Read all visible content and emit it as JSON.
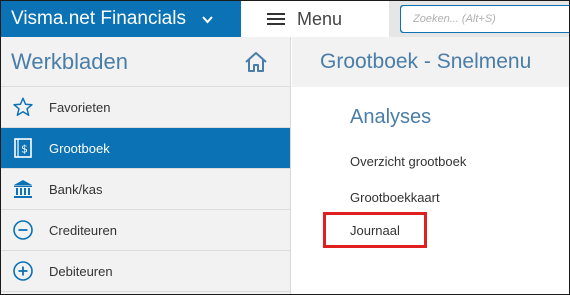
{
  "topbar": {
    "brand": "Visma.net Financials",
    "menu_label": "Menu",
    "search_placeholder": "Zoeken... (Alt+S)",
    "brand_color": "#0a72b5"
  },
  "sidebar": {
    "title": "Werkbladen",
    "items": [
      {
        "label": "Favorieten",
        "icon": "star-icon",
        "active": false
      },
      {
        "label": "Grootboek",
        "icon": "ledger-icon",
        "active": true
      },
      {
        "label": "Bank/kas",
        "icon": "bank-icon",
        "active": false
      },
      {
        "label": "Crediteuren",
        "icon": "minus-circle-icon",
        "active": false
      },
      {
        "label": "Debiteuren",
        "icon": "plus-circle-icon",
        "active": false
      }
    ]
  },
  "main": {
    "title": "Grootboek - Snelmenu",
    "section_title": "Analyses",
    "links": [
      "Overzicht grootboek",
      "Grootboekkaart",
      "Journaal"
    ],
    "highlight_color": "#e0201f"
  }
}
